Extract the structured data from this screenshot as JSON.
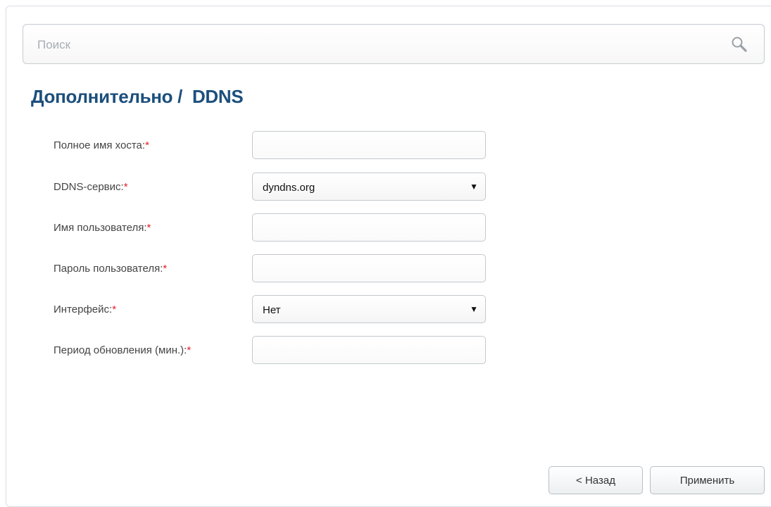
{
  "search": {
    "placeholder": "Поиск",
    "icon": "search-icon"
  },
  "page": {
    "title": "Дополнительно /  DDNS"
  },
  "form": {
    "required_mark": "*",
    "fields": [
      {
        "label": "Полное имя хоста:",
        "type": "text",
        "value": ""
      },
      {
        "label": "DDNS-сервис:",
        "type": "select",
        "value": "dyndns.org"
      },
      {
        "label": "Имя пользователя:",
        "type": "text",
        "value": ""
      },
      {
        "label": "Пароль пользователя:",
        "type": "text",
        "value": ""
      },
      {
        "label": "Интерфейс:",
        "type": "select",
        "value": "Нет"
      },
      {
        "label": "Период обновления (мин.):",
        "type": "text",
        "value": ""
      }
    ],
    "select_arrow": "▼"
  },
  "buttons": {
    "back_label": "< Назад",
    "apply_label": "Применить"
  },
  "colors": {
    "title": "#1c4f7c",
    "required": "#e0202a"
  }
}
